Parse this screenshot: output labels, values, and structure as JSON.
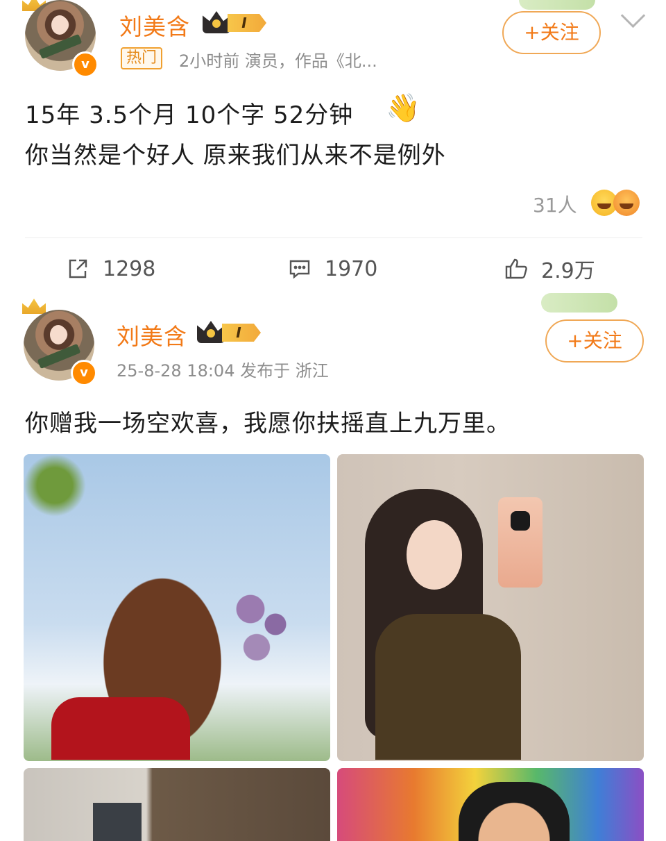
{
  "posts": [
    {
      "author": "刘美含",
      "vip_level": "I",
      "hot_tag": "热门",
      "meta": "2小时前  演员，作品《北...",
      "follow_label": "+关注",
      "lines": [
        "15年 3.5个月 10个字 52分钟",
        "你当然是个好人   原来我们从来不是例外"
      ],
      "emoji": "👋",
      "reaction_count": "31人",
      "actions": {
        "repost": "1298",
        "comment": "1970",
        "like": "2.9万"
      }
    },
    {
      "author": "刘美含",
      "vip_level": "I",
      "meta": "25-8-28 18:04  发布于 浙江",
      "follow_label": "+关注",
      "lines": [
        "你赠我一场空欢喜，我愿你扶摇直上九万里。"
      ]
    }
  ],
  "colors": {
    "accent": "#f27a18",
    "meta_gray": "#8d8d8d"
  },
  "icons": [
    "crown-icon",
    "verified-badge-icon",
    "chevron-down-icon",
    "repost-icon",
    "comment-icon",
    "like-icon"
  ]
}
